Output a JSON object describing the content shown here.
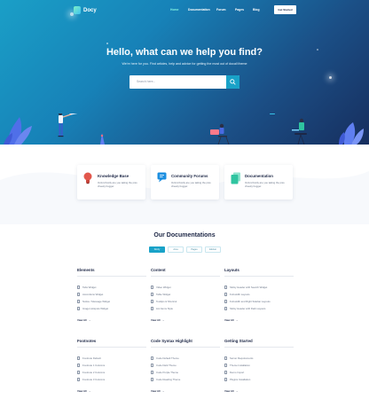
{
  "brand": {
    "name": "Docy"
  },
  "nav": {
    "items": [
      {
        "label": "Home",
        "active": true
      },
      {
        "label": "Documentation",
        "active": false
      },
      {
        "label": "Forum",
        "active": false
      },
      {
        "label": "Pages",
        "active": false
      },
      {
        "label": "Blog",
        "active": false
      }
    ],
    "cta_label": "Get Started"
  },
  "hero": {
    "title": "Hello, what can we help you find?",
    "subtitle": "We're here for you. Find articles, help and advice for getting the most out of docall theme",
    "search_placeholder": "Search here..."
  },
  "features": [
    {
      "title": "Knowledge Base",
      "desc": "Oxford brolly are you taking the piss cheeky bugger.",
      "icon": "lightbulb-icon",
      "color": "#e2574c"
    },
    {
      "title": "Community Forums",
      "desc": "Oxford brolly are you taking the piss cheeky bugger.",
      "icon": "chat-icon",
      "color": "#1d8fe0"
    },
    {
      "title": "Documentation",
      "desc": "Oxford brolly are you taking the piss cheeky bugger.",
      "icon": "documents-icon",
      "color": "#2fc4a0"
    }
  ],
  "docs": {
    "title": "Our Documentations",
    "tabs": [
      "Docly",
      "Ama",
      "Pages",
      "Eticket"
    ],
    "view_all_label": "View All",
    "sections": [
      {
        "title": "Elements",
        "items": [
          "Tabs Widget",
          "Accordions Widget",
          "Notice / Message Widget",
          "Image Hotspots Widget"
        ]
      },
      {
        "title": "Content",
        "items": [
          "Video Widget",
          "Table Widget",
          "Tooltips & Shortcut",
          "List Items Style"
        ]
      },
      {
        "title": "Layouts",
        "items": [
          "Sticky Header with Search Widget",
          "Full-width Layouts",
          "Full-width and Right Sidebar Layouts",
          "Sticky Header with Dark Layouts"
        ]
      },
      {
        "title": "Footnotes",
        "items": [
          "Footnote Default",
          "Footnote 1 Columns",
          "Footnote 2 Columns",
          "Footnote 3 Columns"
        ]
      },
      {
        "title": "Code Syntax Highlight",
        "items": [
          "Code Default Theme",
          "Code Dark Theme",
          "Code Purple Theme",
          "Code Reading Theme"
        ]
      },
      {
        "title": "Getting Started",
        "items": [
          "Server Requirements",
          "Theme Installation",
          "Demo Import",
          "Plugins Installation"
        ]
      }
    ]
  }
}
